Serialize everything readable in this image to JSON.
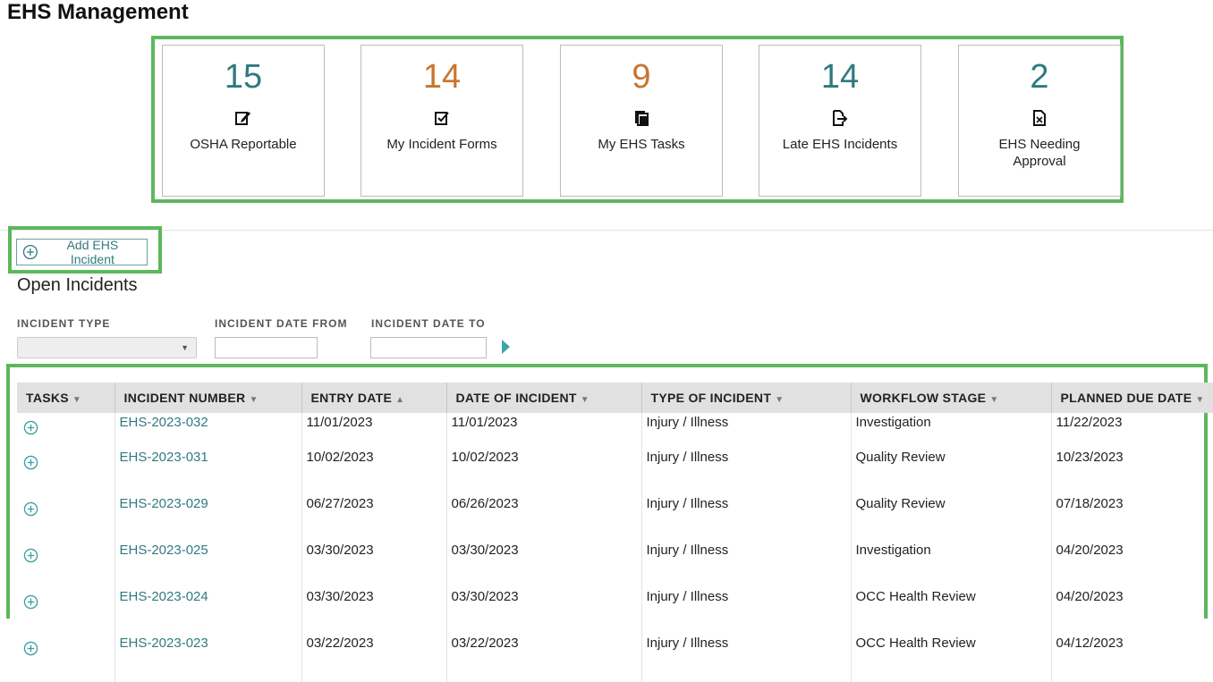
{
  "page": {
    "title": "EHS Management"
  },
  "tiles": [
    {
      "count": "15",
      "label": "OSHA Reportable",
      "icon": "edit-icon",
      "color": "#2f7a7f"
    },
    {
      "count": "14",
      "label": "My Incident Forms",
      "icon": "checkbox-edit-icon",
      "color": "#c8752e"
    },
    {
      "count": "9",
      "label": "My EHS Tasks",
      "icon": "copy-document-icon",
      "color": "#c8752e"
    },
    {
      "count": "14",
      "label": "Late EHS Incidents",
      "icon": "document-export-icon",
      "color": "#2f7a7f"
    },
    {
      "count": "2",
      "label": "EHS Needing Approval",
      "icon": "document-x-icon",
      "color": "#2f7a7f"
    }
  ],
  "actions": {
    "add_incident_label": "Add EHS Incident"
  },
  "section": {
    "title": "Open Incidents"
  },
  "filters": {
    "incident_type_label": "INCIDENT TYPE",
    "incident_type_value": "",
    "date_from_label": "INCIDENT DATE FROM",
    "date_from_value": "",
    "date_to_label": "INCIDENT DATE TO",
    "date_to_value": ""
  },
  "table": {
    "columns": [
      "TASKS",
      "INCIDENT NUMBER",
      "ENTRY DATE",
      "DATE OF INCIDENT",
      "TYPE OF INCIDENT",
      "WORKFLOW STAGE",
      "PLANNED DUE DATE"
    ],
    "sort_column": "ENTRY DATE",
    "rows": [
      {
        "number": "EHS-2023-032",
        "entry": "11/01/2023",
        "incident": "11/01/2023",
        "type": "Injury / Illness",
        "stage": "Investigation",
        "due": "11/22/2023"
      },
      {
        "number": "EHS-2023-031",
        "entry": "10/02/2023",
        "incident": "10/02/2023",
        "type": "Injury / Illness",
        "stage": "Quality Review",
        "due": "10/23/2023"
      },
      {
        "number": "EHS-2023-029",
        "entry": "06/27/2023",
        "incident": "06/26/2023",
        "type": "Injury / Illness",
        "stage": "Quality Review",
        "due": "07/18/2023"
      },
      {
        "number": "EHS-2023-025",
        "entry": "03/30/2023",
        "incident": "03/30/2023",
        "type": "Injury / Illness",
        "stage": "Investigation",
        "due": "04/20/2023"
      },
      {
        "number": "EHS-2023-024",
        "entry": "03/30/2023",
        "incident": "03/30/2023",
        "type": "Injury / Illness",
        "stage": "OCC Health Review",
        "due": "04/20/2023"
      },
      {
        "number": "EHS-2023-023",
        "entry": "03/22/2023",
        "incident": "03/22/2023",
        "type": "Injury / Illness",
        "stage": "OCC Health Review",
        "due": "04/12/2023"
      }
    ]
  },
  "colors": {
    "accent": "#2f7a7f",
    "orange": "#c8752e",
    "highlight": "#5cb85c"
  }
}
